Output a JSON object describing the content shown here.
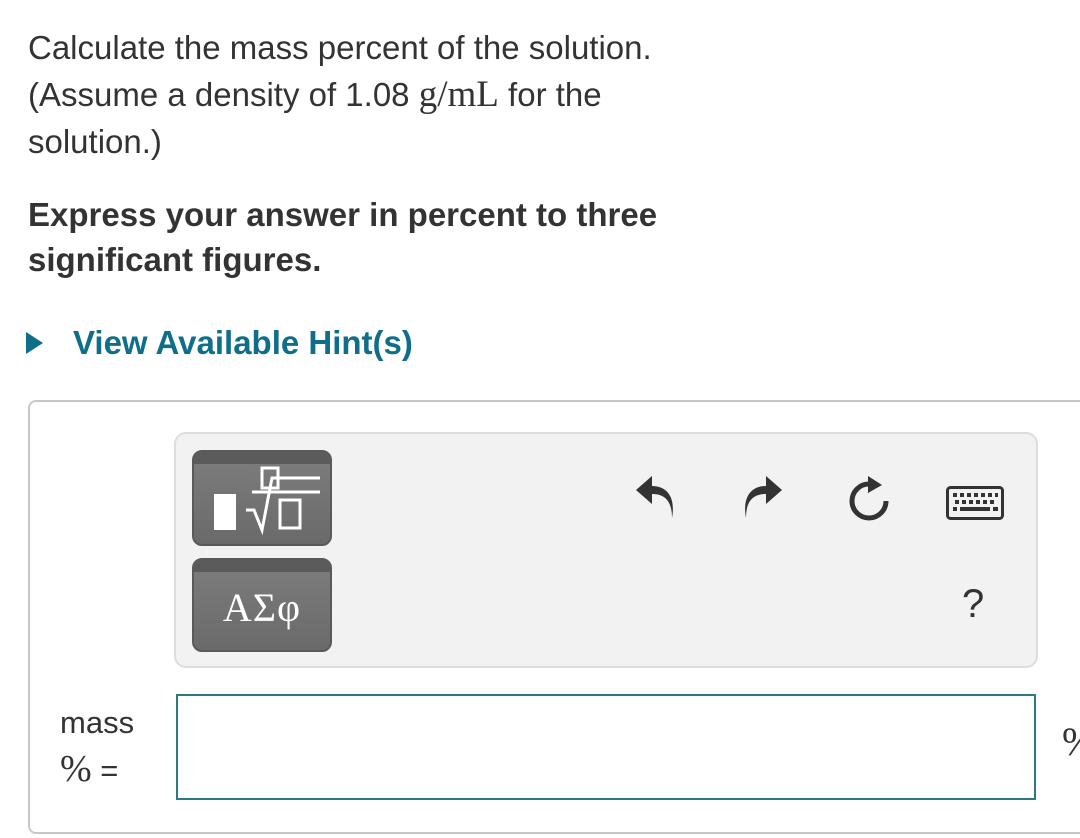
{
  "question": {
    "line1": "Calculate the mass percent of the solution.",
    "line2_pre": "(Assume a density of 1.08 ",
    "line2_math": "g/mL",
    "line2_post": " for the",
    "line3": "solution.)"
  },
  "instruction": {
    "line1": "Express your answer in percent to three",
    "line2": "significant figures."
  },
  "hint": {
    "label": "View Available Hint(s)"
  },
  "toolbar": {
    "templates_icon": "fraction-sqrt-template-icon",
    "symbols_label": "ΑΣφ",
    "undo_icon": "undo-arrow-icon",
    "redo_icon": "redo-arrow-icon",
    "reset_icon": "reset-icon",
    "keyboard_icon": "keyboard-icon",
    "help_label": "?"
  },
  "answer": {
    "variable_word": "mass",
    "variable_symbol": "%",
    "equals": " =",
    "value": "",
    "unit": "%"
  },
  "colors": {
    "link": "#0f6e8a",
    "input_border": "#2a7a86",
    "button_gray": "#737373",
    "toolbar_bg": "#f2f2f2"
  }
}
